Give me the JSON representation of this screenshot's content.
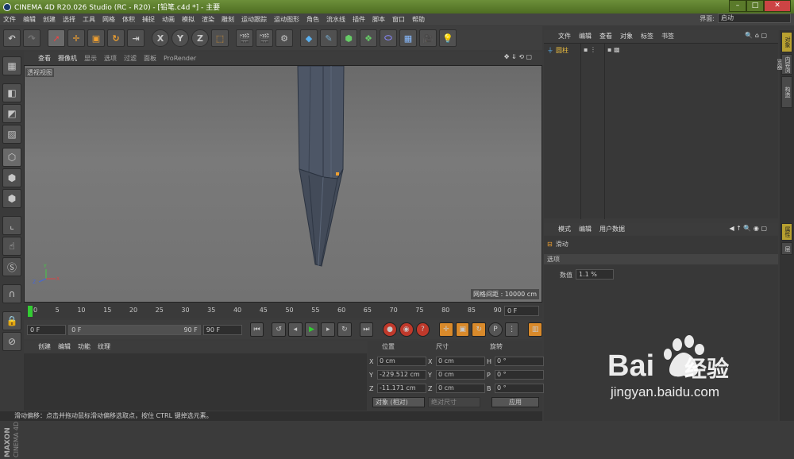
{
  "window": {
    "title": "CINEMA 4D R20.026 Studio (RC - R20) - [铅笔.c4d *] - 主要"
  },
  "menubar": {
    "items": [
      "文件",
      "编辑",
      "创建",
      "选择",
      "工具",
      "网格",
      "体积",
      "捕捉",
      "动画",
      "模拟",
      "渲染",
      "雕刻",
      "运动跟踪",
      "运动图形",
      "角色",
      "流水线",
      "插件",
      "脚本",
      "窗口",
      "帮助"
    ]
  },
  "layout": {
    "label": "界面:",
    "value": "启动"
  },
  "viewport": {
    "menu": [
      "查看",
      "摄像机",
      "显示",
      "选项",
      "过滤",
      "面板",
      "ProRender"
    ],
    "label": "透视视图",
    "grid_info": "网格间距 : 10000 cm"
  },
  "timeline": {
    "ticks": [
      "0",
      "5",
      "10",
      "15",
      "20",
      "25",
      "30",
      "35",
      "40",
      "45",
      "50",
      "55",
      "60",
      "65",
      "70",
      "75",
      "80",
      "85",
      "90"
    ],
    "frame_end_field": "0 F",
    "start": "0 F",
    "range_start": "0 F",
    "range_end": "90 F",
    "end": "90 F"
  },
  "materials": {
    "menu": [
      "创建",
      "编辑",
      "功能",
      "纹理"
    ]
  },
  "coords": {
    "headers": [
      "位置",
      "尺寸",
      "旋转"
    ],
    "rows": [
      {
        "a": "X",
        "p": "0 cm",
        "b": "X",
        "s": "0 cm",
        "c": "H",
        "r": "0 °"
      },
      {
        "a": "Y",
        "p": "-229.512 cm",
        "b": "Y",
        "s": "0 cm",
        "c": "P",
        "r": "0 °"
      },
      {
        "a": "Z",
        "p": "-11.171 cm",
        "b": "Z",
        "s": "0 cm",
        "c": "B",
        "r": "0 °"
      }
    ],
    "object_mode": "对象 (相对)",
    "size_mode": "绝对尺寸",
    "apply": "应用"
  },
  "status": "滑动偏移：点击并拖动鼠标滑动偏移选取点，按住 CTRL 键掉选元素。",
  "objects": {
    "menu": [
      "文件",
      "编辑",
      "查看",
      "对象",
      "标签",
      "书签"
    ],
    "items": [
      {
        "name": "圆柱"
      }
    ]
  },
  "attributes": {
    "menu": [
      "模式",
      "编辑",
      "用户数据"
    ],
    "tool_name": "滑动",
    "section": "选项",
    "field_label": "数值",
    "field_value": "1.1 %"
  },
  "right_tabs": [
    "对象",
    "内容浏览器",
    "构造",
    "属性",
    "层"
  ],
  "watermark": {
    "brand": "Bai",
    "suffix": "经验",
    "url": "jingyan.baidu.com"
  },
  "colors": {
    "titlebar": "#5a7a2a",
    "accent_orange": "#d98a2b",
    "record_red": "#c0392b",
    "panel": "#383838"
  }
}
